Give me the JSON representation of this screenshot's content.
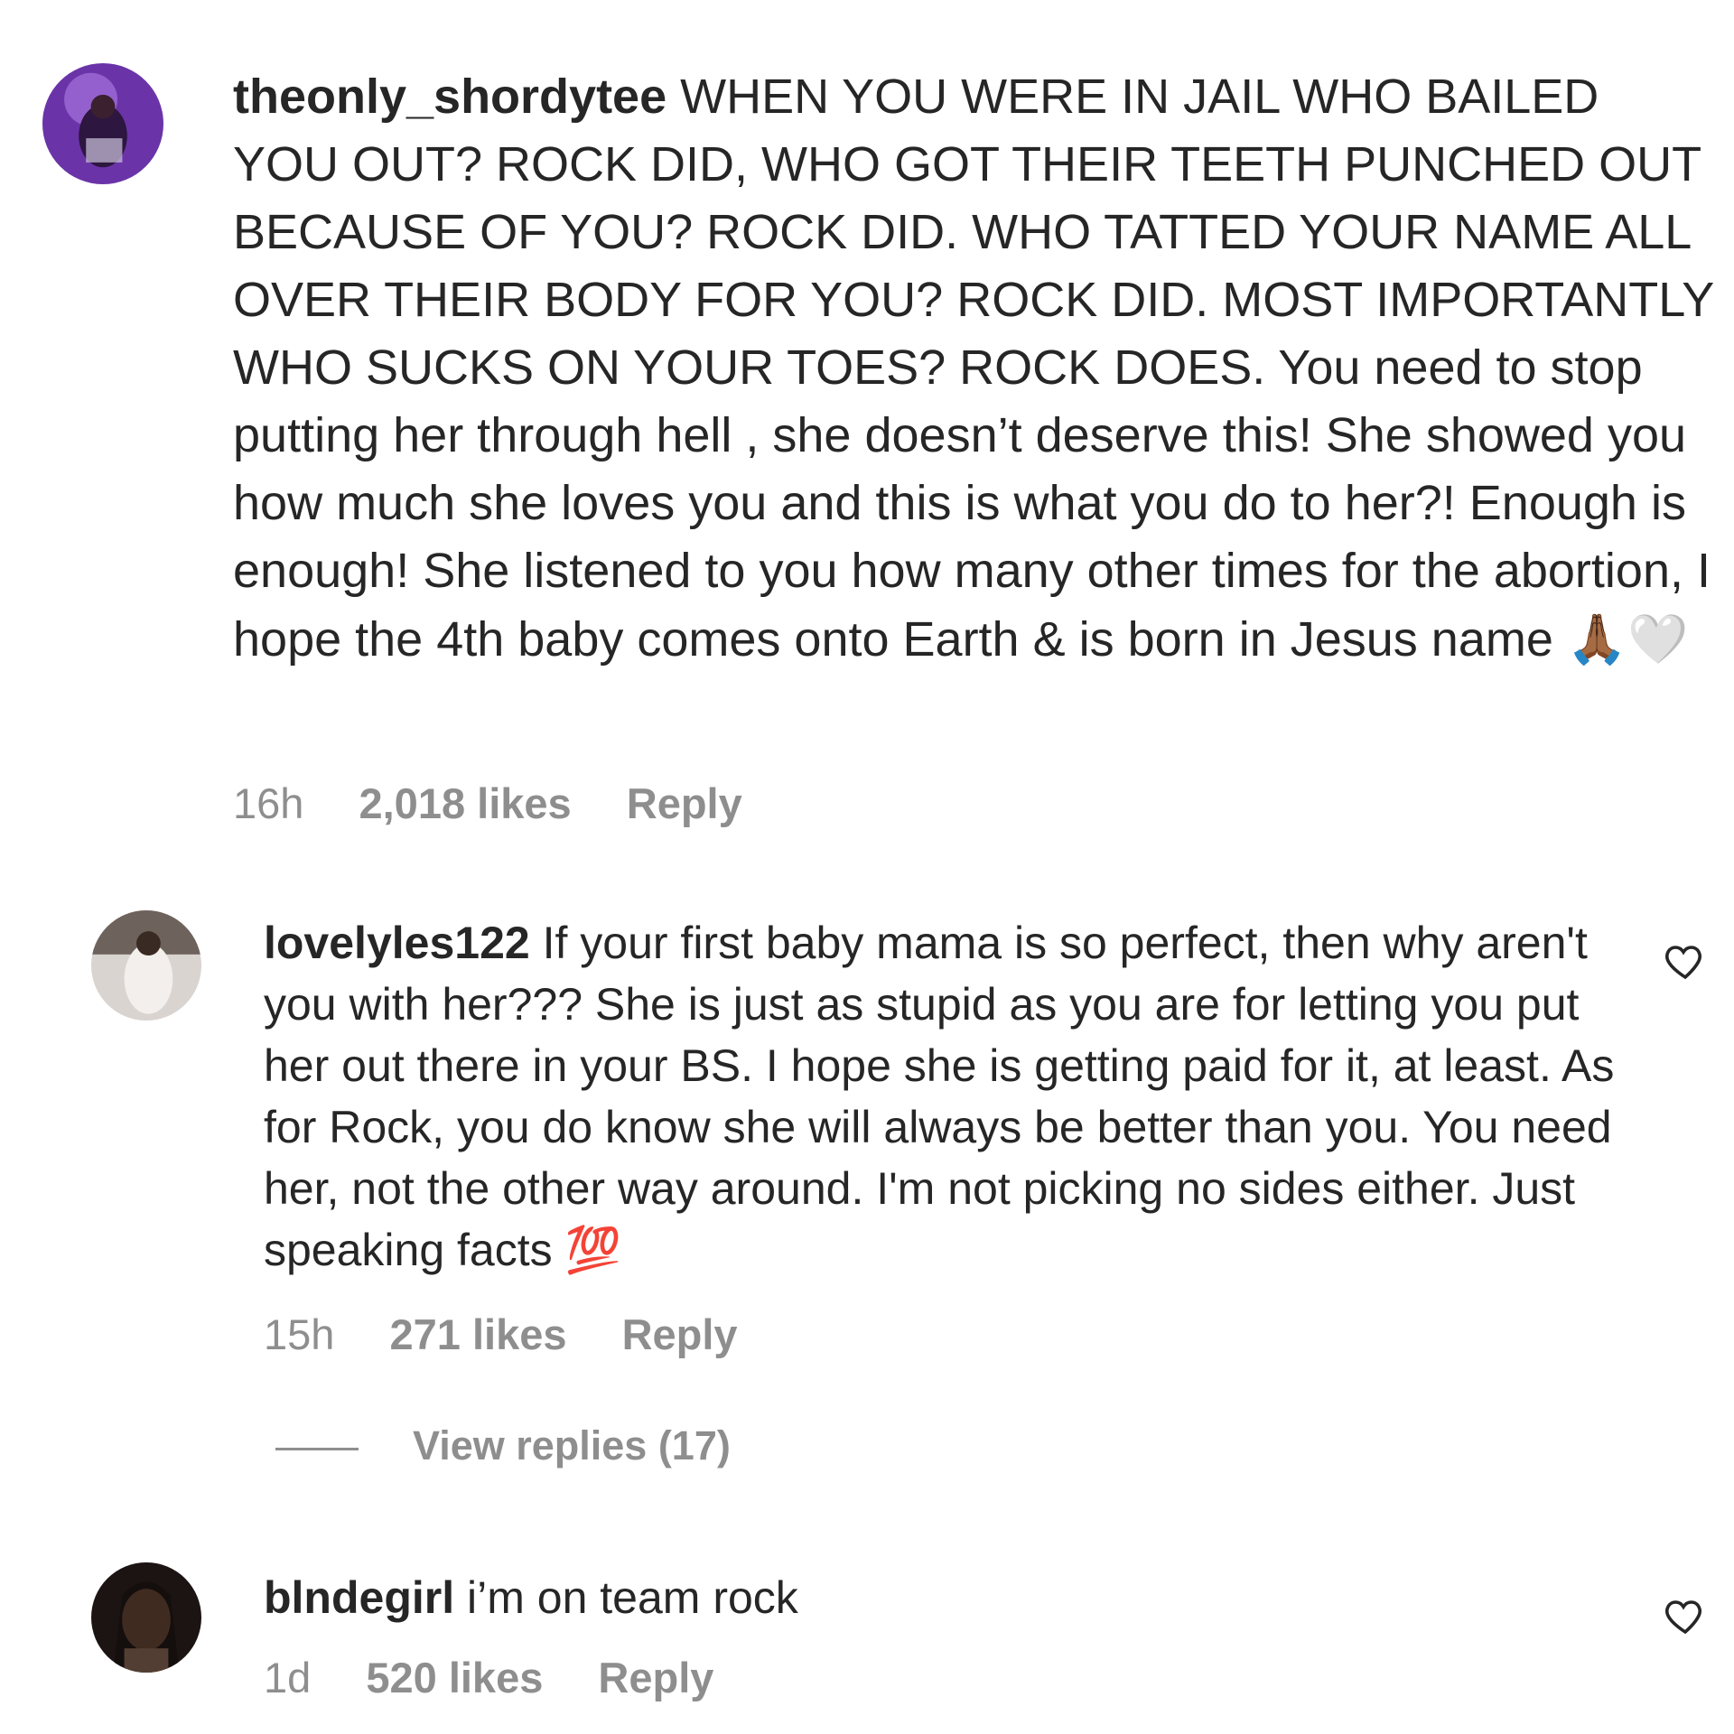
{
  "comments": [
    {
      "username": "theonly_shordytee",
      "text": "WHEN YOU WERE IN JAIL WHO BAILED YOU OUT? ROCK DID, WHO GOT THEIR TEETH PUNCHED OUT BECAUSE OF YOU? ROCK DID. WHO TATTED YOUR NAME ALL OVER THEIR BODY FOR YOU? ROCK DID. MOST IMPORTANTLY WHO SUCKS ON YOUR TOES? ROCK DOES. You need to stop putting her through hell , she doesn’t deserve this! She showed you how much she loves you and this is what you do to her?! Enough is enough! She listened to you how many other times for the abortion, I hope the 4th baby comes onto Earth & is born in Jesus name",
      "emoji": "🙏🏾🤍",
      "time": "16h",
      "likes": "2,018 likes",
      "reply": "Reply",
      "avatar_colors": [
        "#5b2b8c",
        "#8a52c4"
      ]
    },
    {
      "username": "lovelyles122",
      "text": "If your first baby mama is so perfect, then why aren't you with her??? She is just as stupid as you are for letting you put her out there in your BS. I hope she is getting paid for it, at least. As for Rock, you do know she will always be better than you. You need her, not the other way around. I'm not picking no sides either. Just speaking facts",
      "emoji": "💯",
      "time": "15h",
      "likes": "271 likes",
      "reply": "Reply",
      "view_replies": "View replies (17)",
      "avatar_colors": [
        "#c9c4c0",
        "#4a3f3a"
      ]
    },
    {
      "username": "blndegirl",
      "text": "i’m on team rock",
      "emoji": "",
      "time": "1d",
      "likes": "520 likes",
      "reply": "Reply",
      "avatar_colors": [
        "#2b1d18",
        "#a0745a"
      ]
    }
  ],
  "icons": {
    "like": "heart-outline-icon"
  }
}
